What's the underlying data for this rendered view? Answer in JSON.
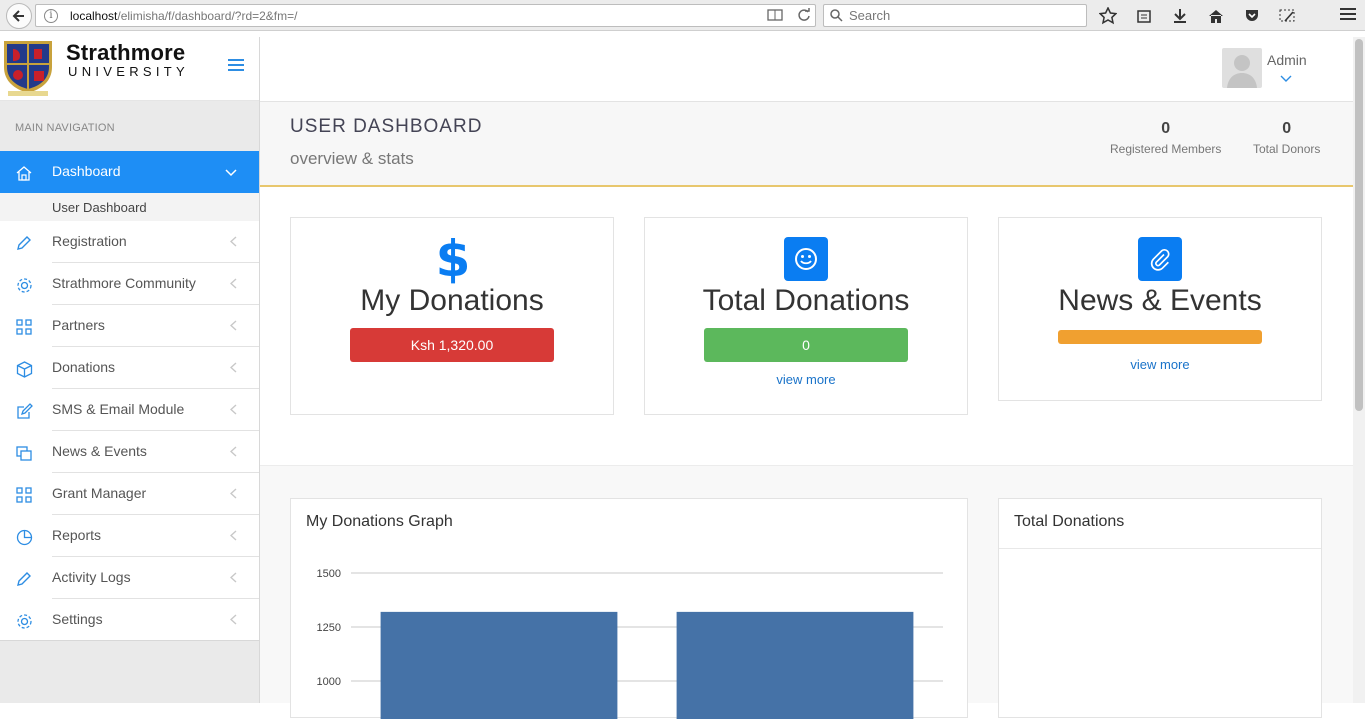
{
  "browser": {
    "url_host": "localhost",
    "url_path": "/elimisha/f/dashboard/?rd=2&fm=/",
    "search_placeholder": "Search"
  },
  "brand": {
    "name": "Strathmore",
    "sub": "UNIVERSITY"
  },
  "sidebar": {
    "heading": "MAIN NAVIGATION",
    "items": [
      {
        "label": "Dashboard",
        "icon": "home-icon",
        "active": true
      },
      {
        "label": "Registration",
        "icon": "pencil-icon"
      },
      {
        "label": "Strathmore Community",
        "icon": "gear-icon"
      },
      {
        "label": "Partners",
        "icon": "grid-icon"
      },
      {
        "label": "Donations",
        "icon": "box-icon"
      },
      {
        "label": "SMS & Email Module",
        "icon": "edit-icon"
      },
      {
        "label": "News & Events",
        "icon": "copy-icon"
      },
      {
        "label": "Grant Manager",
        "icon": "grid-icon"
      },
      {
        "label": "Reports",
        "icon": "pie-icon"
      },
      {
        "label": "Activity Logs",
        "icon": "pencil-icon"
      },
      {
        "label": "Settings",
        "icon": "gear-icon"
      }
    ],
    "sub_item": "User Dashboard"
  },
  "header": {
    "user_name": "Admin"
  },
  "page": {
    "title": "USER DASHBOARD",
    "subtitle": "overview & stats",
    "stats": [
      {
        "value": "0",
        "label": "Registered Members"
      },
      {
        "value": "0",
        "label": "Total Donors"
      }
    ]
  },
  "cards": [
    {
      "title": "My Donations",
      "bar_text": "Ksh 1,320.00",
      "bar_color": "#d73a37",
      "icon": "dollar-icon"
    },
    {
      "title": "Total Donations",
      "bar_text": "0",
      "bar_color": "#5cb85c",
      "link": "view more",
      "icon": "smile-icon"
    },
    {
      "title": "News & Events",
      "bar_text": "",
      "bar_color": "#f0a030",
      "link": "view more",
      "icon": "paperclip-icon"
    }
  ],
  "panels": {
    "graph_title": "My Donations Graph",
    "total_title": "Total Donations"
  },
  "chart_data": {
    "type": "bar",
    "categories": [
      "",
      ""
    ],
    "values": [
      1320,
      1320
    ],
    "yticks": [
      1000,
      1250,
      1500
    ],
    "ylim": [
      1000,
      1500
    ],
    "bar_color": "#4572a7"
  }
}
